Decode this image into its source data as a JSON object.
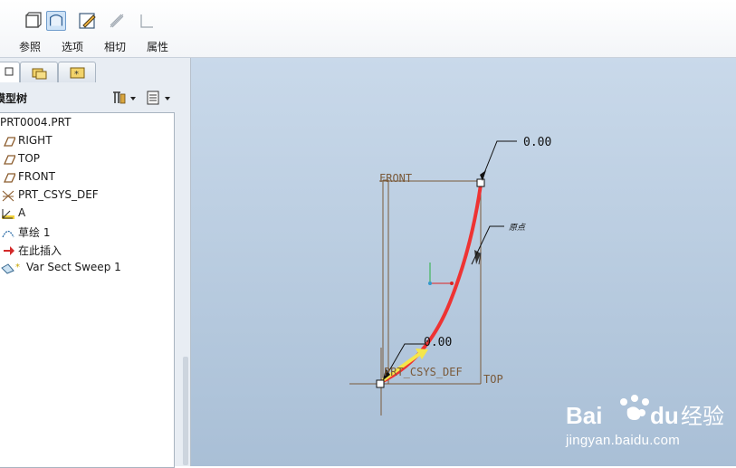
{
  "toolbar": {
    "items": [
      {
        "label": "参照",
        "icon": "reference-icon"
      },
      {
        "label": "选项",
        "icon": "options-icon"
      },
      {
        "label": "相切",
        "icon": "tangent-icon"
      },
      {
        "label": "属性",
        "icon": "properties-icon"
      }
    ]
  },
  "panel": {
    "title": "模型树",
    "tree": [
      {
        "label": "PRT0004.PRT",
        "icon": "part-icon"
      },
      {
        "label": "RIGHT",
        "icon": "datum-plane-icon"
      },
      {
        "label": "TOP",
        "icon": "datum-plane-icon"
      },
      {
        "label": "FRONT",
        "icon": "datum-plane-icon"
      },
      {
        "label": "PRT_CSYS_DEF",
        "icon": "csys-icon"
      },
      {
        "label": "A",
        "icon": "datum-axis-icon"
      },
      {
        "label": "草绘 1",
        "icon": "sketch-icon"
      },
      {
        "label": "在此插入",
        "icon": "insert-arrow-icon"
      },
      {
        "label": "Var Sect Sweep 1",
        "icon": "sweep-icon"
      }
    ]
  },
  "view": {
    "dim_top": "0.00",
    "dim_bottom": "0.00",
    "label_front": "FRONT",
    "label_top": "TOP",
    "label_csys": "PRT_CSYS_DEF",
    "label_start": "原点"
  },
  "colors": {
    "trajectory": "#ee3333",
    "datum": "#7a5a3a",
    "start_arrow": "#f5e64a"
  },
  "watermark": {
    "brand": "Baidu经验",
    "url": "jingyan.baidu.com"
  }
}
